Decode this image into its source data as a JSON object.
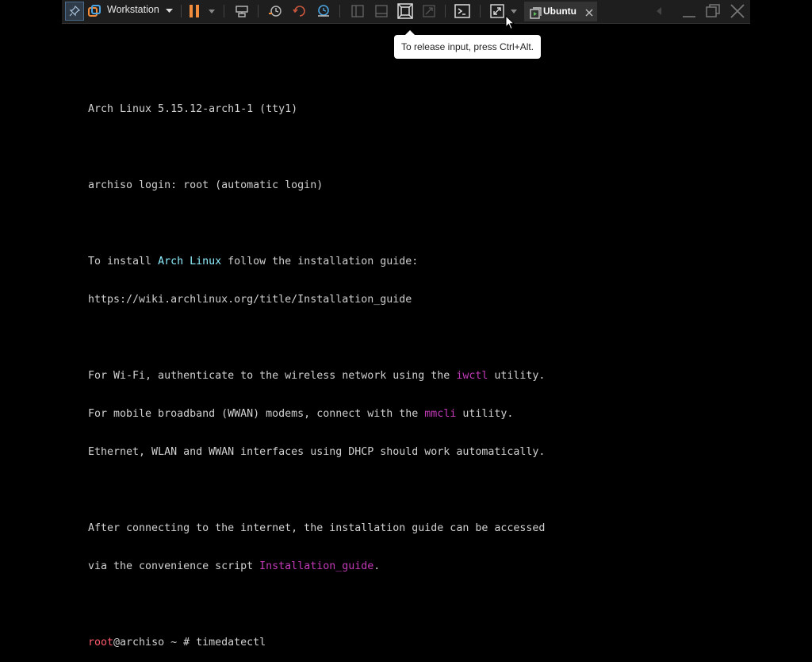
{
  "toolbar": {
    "product_label": "Workstation",
    "vm_tab_label": "Ubuntu"
  },
  "tooltip": {
    "text": "To release input, press Ctrl+Alt."
  },
  "terminal": {
    "l1": "Arch Linux 5.15.12-arch1-1 (tty1)",
    "l2": "archiso login: root (automatic login)",
    "l3a": "To install ",
    "l3b": "Arch Linux",
    "l3c": " follow the installation guide:",
    "l4": "https://wiki.archlinux.org/title/Installation_guide",
    "l5a": "For Wi-Fi, authenticate to the wireless network using the ",
    "l5b": "iwctl",
    "l5c": " utility.",
    "l6a": "For mobile broadband (WWAN) modems, connect with the ",
    "l6b": "mmcli",
    "l6c": " utility.",
    "l7": "Ethernet, WLAN and WWAN interfaces using DHCP should work automatically.",
    "l8": "After connecting to the internet, the installation guide can be accessed",
    "l9a": "via the convenience script ",
    "l9b": "Installation_guide",
    "l9c": ".",
    "prompt_user": "root",
    "prompt_rest": "@archiso ~ # ",
    "command": "timedatectl"
  },
  "colors": {
    "toolbar_bg": "#1e1e1e",
    "pause_orange": "#f08c3c",
    "link_cyan": "#8fefff",
    "cmd_magenta": "#c23ab6",
    "prompt_red": "#ff5b6a"
  }
}
